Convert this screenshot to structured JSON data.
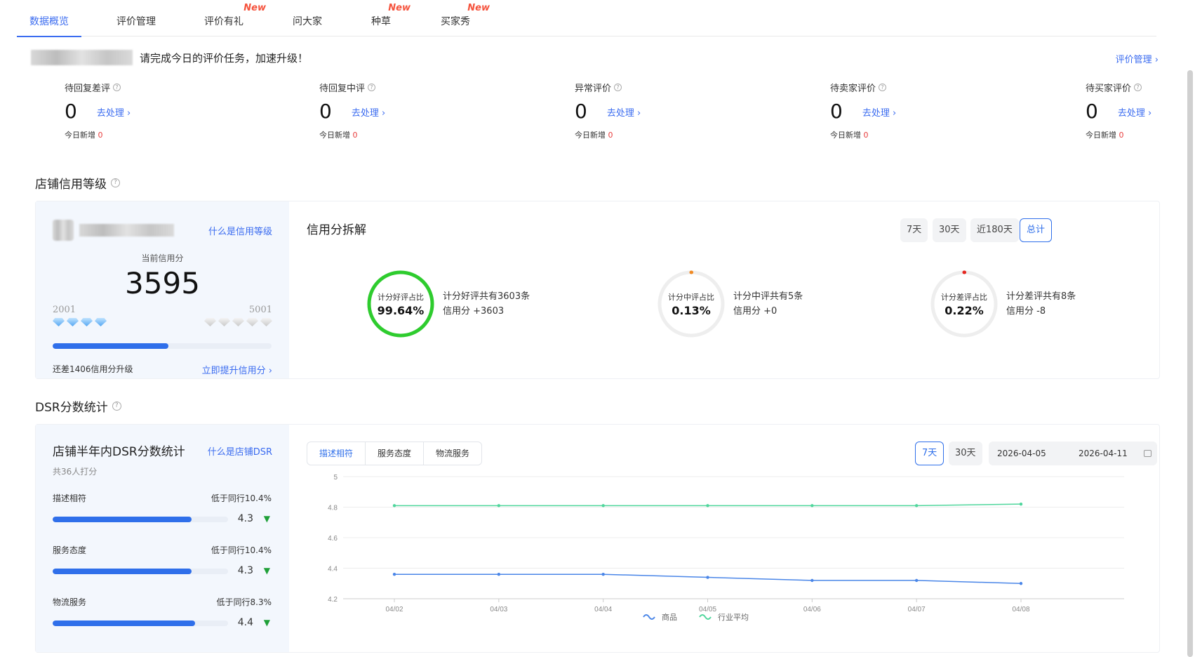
{
  "tabs": [
    {
      "label": "数据概览",
      "active": true,
      "new": ""
    },
    {
      "label": "评价管理",
      "active": false,
      "new": ""
    },
    {
      "label": "评价有礼",
      "active": false,
      "new": "New"
    },
    {
      "label": "问大家",
      "active": false,
      "new": ""
    },
    {
      "label": "种草",
      "active": false,
      "new": "New"
    },
    {
      "label": "买家秀",
      "active": false,
      "new": "New"
    }
  ],
  "notice": {
    "text": "请完成今日的评价任务，加速升级！",
    "manage_link": "评价管理 ›"
  },
  "stats": [
    {
      "label": "待回复差评",
      "value": "0",
      "action": "去处理 ›",
      "today_label": "今日新增",
      "today_value": "0"
    },
    {
      "label": "待回复中评",
      "value": "0",
      "action": "去处理 ›",
      "today_label": "今日新增",
      "today_value": "0"
    },
    {
      "label": "异常评价",
      "value": "0",
      "action": "去处理 ›",
      "today_label": "今日新增",
      "today_value": "0"
    },
    {
      "label": "待卖家评价",
      "value": "0",
      "action": "去处理 ›",
      "today_label": "今日新增",
      "today_value": "0"
    },
    {
      "label": "待买家评价",
      "value": "0",
      "action": "去处理 ›",
      "today_label": "今日新增",
      "today_value": "0"
    }
  ],
  "credit": {
    "section_title": "店铺信用等级",
    "what_link": "什么是信用等级",
    "current_label": "当前信用分",
    "score": "3595",
    "range_min": "2001",
    "range_max": "5001",
    "progress": 0.53,
    "gap_text": "还差1406信用分升级",
    "upgrade_link": "立即提升信用分 ›",
    "decomp_title": "信用分拆解",
    "periods": [
      {
        "label": "7天",
        "active": false
      },
      {
        "label": "30天",
        "active": false
      },
      {
        "label": "近180天",
        "active": false
      },
      {
        "label": "总计",
        "active": true
      }
    ],
    "rings": [
      {
        "label": "计分好评占比",
        "value": "99.64%",
        "ratio": 0.9964,
        "color": "#2ecc2e",
        "line1": "计分好评共有3603条",
        "line2": "信用分 +3603"
      },
      {
        "label": "计分中评占比",
        "value": "0.13%",
        "ratio": 0.0013,
        "color": "#f08a24",
        "line1": "计分中评共有5条",
        "line2": "信用分 +0"
      },
      {
        "label": "计分差评占比",
        "value": "0.22%",
        "ratio": 0.0022,
        "color": "#e5261f",
        "line1": "计分差评共有8条",
        "line2": "信用分 -8"
      }
    ]
  },
  "dsr": {
    "section_title": "DSR分数统计",
    "panel_title": "店铺半年内DSR分数统计",
    "what_link": "什么是店铺DSR",
    "count_text": "共36人打分",
    "items": [
      {
        "name": "描述相符",
        "compare": "低于同行10.4%",
        "score": "4.3",
        "ratio": 0.79,
        "trend": "▼"
      },
      {
        "name": "服务态度",
        "compare": "低于同行10.4%",
        "score": "4.3",
        "ratio": 0.79,
        "trend": "▼"
      },
      {
        "name": "物流服务",
        "compare": "低于同行8.3%",
        "score": "4.4",
        "ratio": 0.81,
        "trend": "▼"
      }
    ],
    "seg_tabs": [
      {
        "label": "描述相符",
        "active": true
      },
      {
        "label": "服务态度",
        "active": false
      },
      {
        "label": "物流服务",
        "active": false
      }
    ],
    "periods": [
      {
        "label": "7天",
        "active": true
      },
      {
        "label": "30天",
        "active": false
      }
    ],
    "date_start": "2026-04-05",
    "date_end": "2026-04-11"
  },
  "chart_data": {
    "type": "line",
    "x": [
      "04/02",
      "04/03",
      "04/04",
      "04/05",
      "04/06",
      "04/07",
      "04/08"
    ],
    "ylim": [
      4.2,
      5
    ],
    "yticks": [
      "4.2",
      "4.4",
      "4.6",
      "4.8",
      "5"
    ],
    "grid": true,
    "legend": "bottom",
    "series": [
      {
        "name": "商品",
        "color": "#4a86e8",
        "values": [
          4.36,
          4.36,
          4.36,
          4.34,
          4.32,
          4.32,
          4.3
        ]
      },
      {
        "name": "行业平均",
        "color": "#4fd69c",
        "values": [
          4.81,
          4.81,
          4.81,
          4.81,
          4.81,
          4.81,
          4.82
        ]
      }
    ]
  }
}
